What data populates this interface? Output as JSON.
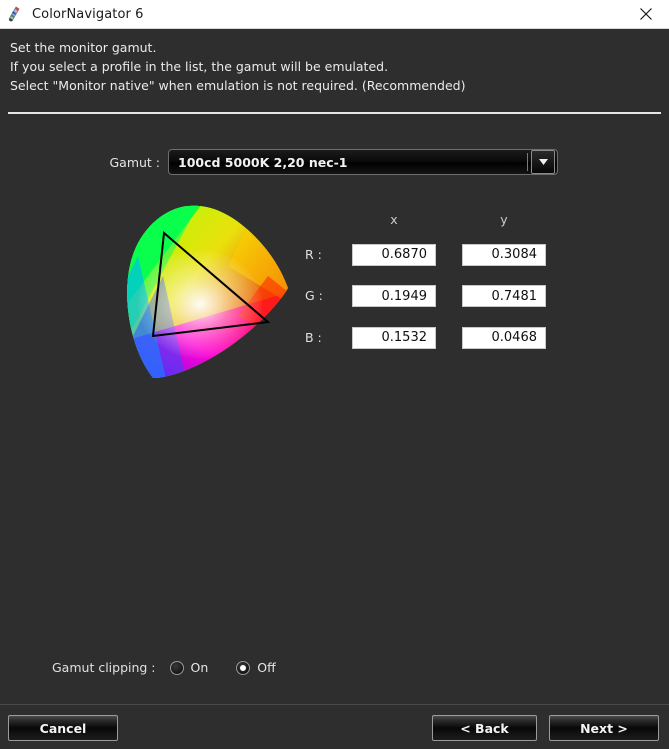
{
  "window": {
    "title": "ColorNavigator 6",
    "app_icon": "colornavigator-icon",
    "close_icon": "close-icon"
  },
  "header": {
    "line1": "Set the monitor gamut.",
    "line2": "If you select a profile in the list, the gamut will be emulated.",
    "line3": "Select \"Monitor native\" when emulation is not required. (Recommended)"
  },
  "gamut": {
    "label": "Gamut :",
    "selected": "100cd 5000K 2,20 nec-1",
    "arrow_icon": "chevron-down-icon"
  },
  "coordinates": {
    "col_x": "x",
    "col_y": "y",
    "rows": [
      {
        "label": "R :",
        "x": "0.6870",
        "y": "0.3084"
      },
      {
        "label": "G :",
        "x": "0.1949",
        "y": "0.7481"
      },
      {
        "label": "B :",
        "x": "0.1532",
        "y": "0.0468"
      }
    ]
  },
  "gamut_clipping": {
    "label": "Gamut clipping :",
    "on_label": "On",
    "off_label": "Off",
    "selected": "Off"
  },
  "buttons": {
    "cancel": "Cancel",
    "back": "< Back",
    "next": "Next >"
  },
  "colors": {
    "window_bg": "#2e2e2e",
    "titlebar_bg": "#ffffff",
    "text": "#e8e8e8",
    "field_bg": "#ffffff",
    "rule": "#e6e6e6"
  }
}
